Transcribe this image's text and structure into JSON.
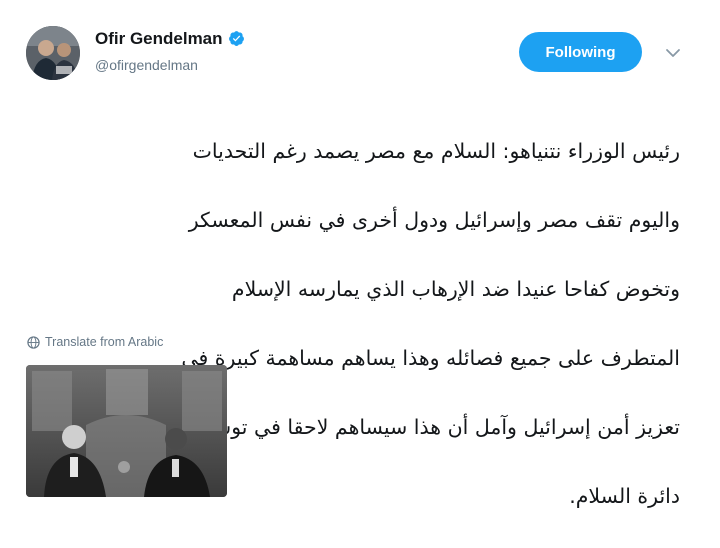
{
  "author": {
    "name": "Ofir Gendelman",
    "handle": "@ofirgendelman",
    "verified": true
  },
  "actions": {
    "follow_label": "Following"
  },
  "tweet": {
    "text_lines": [
      "رئيس الوزراء نتنياهو: السلام مع مصر يصمد رغم التحديات",
      "واليوم تقف مصر وإسرائيل ودول أخرى في نفس المعسكر",
      "وتخوض كفاحا عنيدا ضد الإرهاب الذي يمارسه الإسلام",
      "المتطرف على جميع فصائله وهذا يساهم مساهمة كبيرة في",
      "تعزيز أمن إسرائيل وآمل أن هذا سيساهم لاحقا في توسيع",
      "دائرة السلام."
    ],
    "translate_label": "Translate from Arabic"
  },
  "colors": {
    "accent": "#1da1f2",
    "secondary_text": "#657786"
  },
  "icons": {
    "verified": "verified-badge-icon",
    "caret": "chevron-down-icon",
    "globe": "globe-icon"
  }
}
